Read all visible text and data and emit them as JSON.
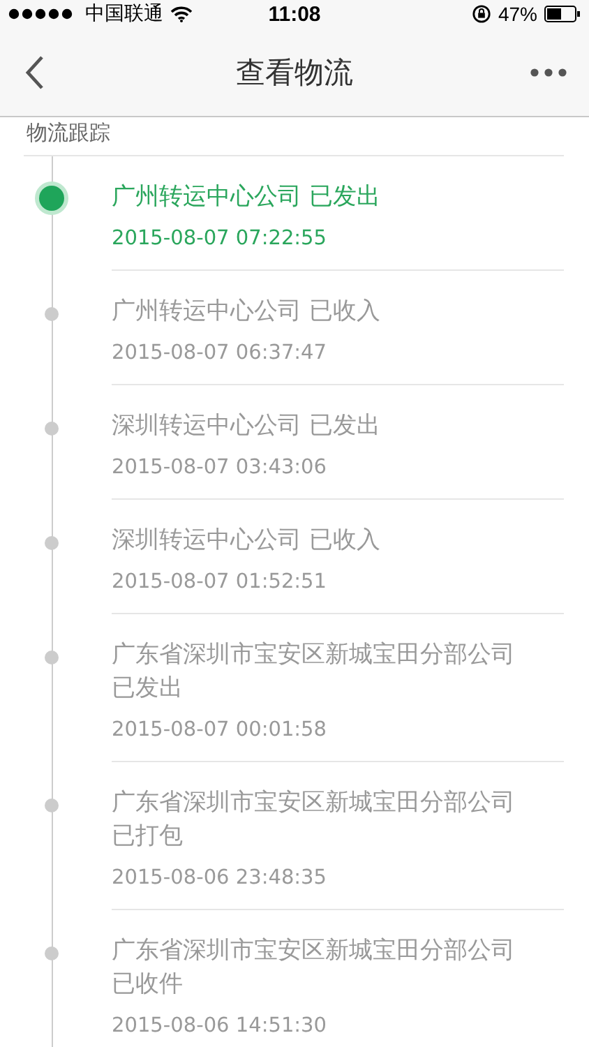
{
  "status_bar": {
    "carrier": "中国联通",
    "time": "11:08",
    "battery": "47%"
  },
  "nav": {
    "title": "查看物流"
  },
  "section_title": "物流跟踪",
  "events": [
    {
      "title": "广州转运中心公司 已发出",
      "time": "2015-08-07 07:22:55",
      "current": true
    },
    {
      "title": "广州转运中心公司 已收入",
      "time": "2015-08-07 06:37:47",
      "current": false
    },
    {
      "title": "深圳转运中心公司 已发出",
      "time": "2015-08-07 03:43:06",
      "current": false
    },
    {
      "title": "深圳转运中心公司 已收入",
      "time": "2015-08-07 01:52:51",
      "current": false
    },
    {
      "title": "广东省深圳市宝安区新城宝田分部公司已发出",
      "time": "2015-08-07 00:01:58",
      "current": false
    },
    {
      "title": "广东省深圳市宝安区新城宝田分部公司已打包",
      "time": "2015-08-06 23:48:35",
      "current": false
    },
    {
      "title": "广东省深圳市宝安区新城宝田分部公司已收件",
      "time": "2015-08-06 14:51:30",
      "current": false
    }
  ]
}
